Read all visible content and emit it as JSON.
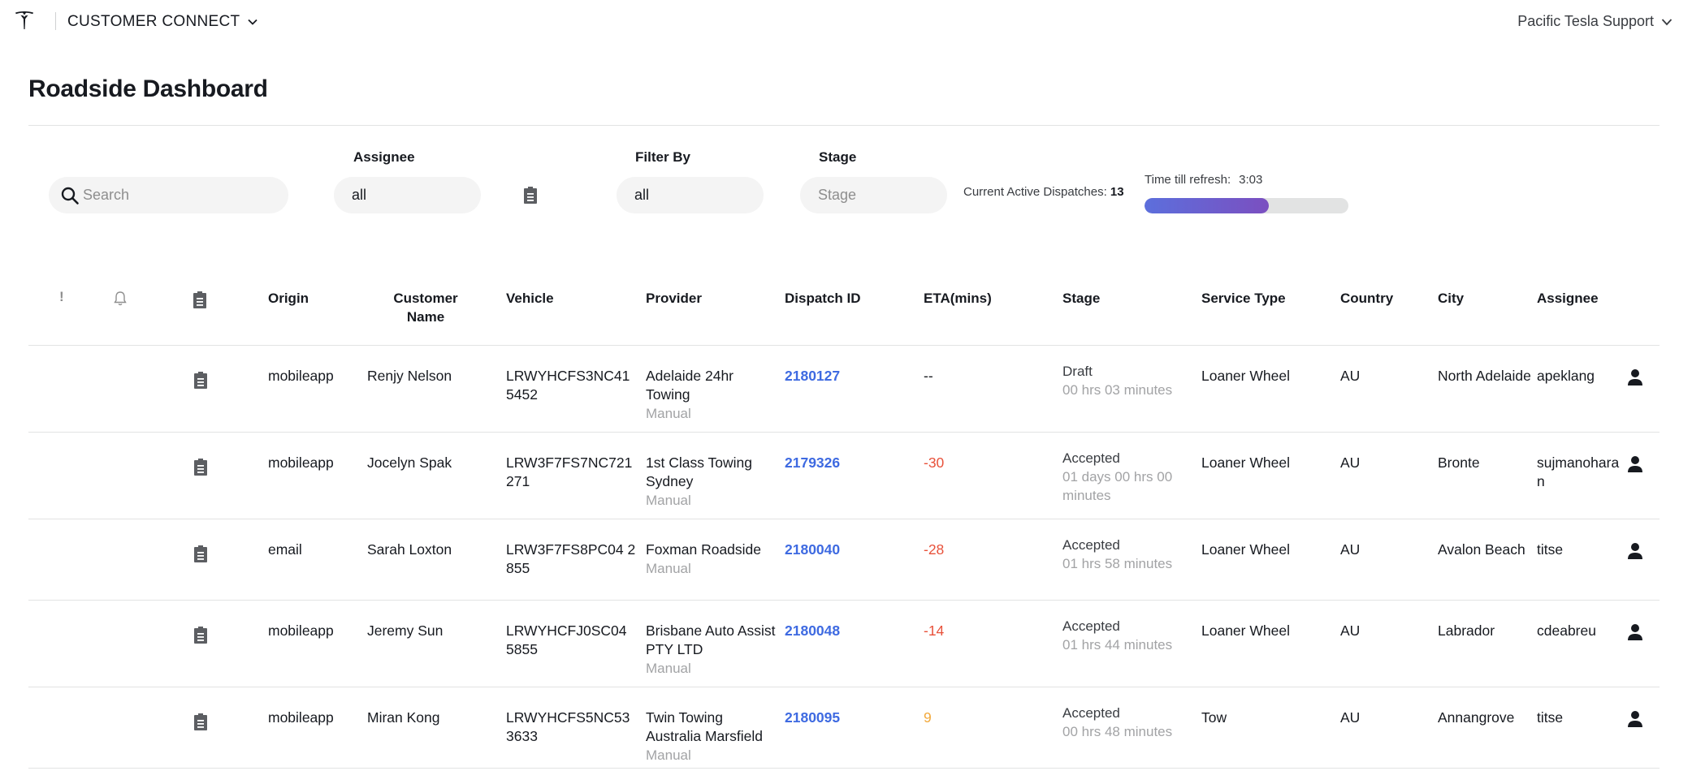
{
  "header": {
    "app_name": "CUSTOMER CONNECT",
    "org_name": "Pacific Tesla Support",
    "logo": "tesla-logo"
  },
  "page": {
    "title": "Roadside Dashboard"
  },
  "filters": {
    "search_placeholder": "Search",
    "assignee_label": "Assignee",
    "assignee_value": "all",
    "filter_by_label": "Filter By",
    "filter_by_value": "all",
    "stage_label": "Stage",
    "stage_placeholder": "Stage",
    "active_dispatches_label": "Current Active Dispatches:",
    "active_dispatches_count": "13",
    "refresh_label": "Time till refresh:",
    "refresh_time": "3:03",
    "refresh_progress_fraction": 0.61,
    "progress_gradient": [
      "#5c6fdc",
      "#7b4fc0"
    ]
  },
  "table": {
    "columns": {
      "priority": "!",
      "origin": "Origin",
      "customer_name": "Customer Name",
      "vehicle": "Vehicle",
      "provider": "Provider",
      "dispatch_id": "Dispatch ID",
      "eta": "ETA(mins)",
      "stage": "Stage",
      "service_type": "Service Type",
      "country": "Country",
      "city": "City",
      "assignee": "Assignee"
    },
    "rows": [
      {
        "origin": "mobileapp",
        "customer": "Renjy Nelson",
        "vehicle": "LRWYHCFS3NC41 5452",
        "provider": "Adelaide 24hr Towing",
        "provider_type": "Manual",
        "dispatch_id": "2180127",
        "eta": "--",
        "eta_kind": "none",
        "stage": "Draft",
        "stage_duration": "00 hrs 03 minutes",
        "service_type": "Loaner Wheel",
        "country": "AU",
        "city": "North Adelaide",
        "assignee": "apeklang"
      },
      {
        "origin": "mobileapp",
        "customer": "Jocelyn Spak",
        "vehicle": "LRW3F7FS7NC721 271",
        "provider": "1st Class Towing Sydney",
        "provider_type": "Manual",
        "dispatch_id": "2179326",
        "eta": "-30",
        "eta_kind": "neg",
        "stage": "Accepted",
        "stage_duration": "01 days 00 hrs 00 minutes",
        "service_type": "Loaner Wheel",
        "country": "AU",
        "city": "Bronte",
        "assignee": "sujmanoharan"
      },
      {
        "origin": "email",
        "customer": "Sarah Loxton",
        "vehicle": "LRW3F7FS8PC04 2855",
        "provider": "Foxman Roadside",
        "provider_type": "Manual",
        "dispatch_id": "2180040",
        "eta": "-28",
        "eta_kind": "neg",
        "stage": "Accepted",
        "stage_duration": "01 hrs 58 minutes",
        "service_type": "Loaner Wheel",
        "country": "AU",
        "city": "Avalon Beach",
        "assignee": "titse"
      },
      {
        "origin": "mobileapp",
        "customer": "Jeremy Sun",
        "vehicle": "LRWYHCFJ0SC04 5855",
        "provider": "Brisbane Auto Assist PTY LTD",
        "provider_type": "Manual",
        "dispatch_id": "2180048",
        "eta": "-14",
        "eta_kind": "neg",
        "stage": "Accepted",
        "stage_duration": "01 hrs 44 minutes",
        "service_type": "Loaner Wheel",
        "country": "AU",
        "city": "Labrador",
        "assignee": "cdeabreu"
      },
      {
        "origin": "mobileapp",
        "customer": "Miran Kong",
        "vehicle": "LRWYHCFS5NC53 3633",
        "provider": "Twin Towing Australia Marsfield",
        "provider_type": "Manual",
        "dispatch_id": "2180095",
        "eta": "9",
        "eta_kind": "pos",
        "stage": "Accepted",
        "stage_duration": "00 hrs 48 minutes",
        "service_type": "Tow",
        "country": "AU",
        "city": "Annangrove",
        "assignee": "titse"
      }
    ]
  },
  "colors": {
    "link": "#3e6ae1",
    "eta_negative": "#e8513a",
    "eta_positive": "#f2a93b",
    "muted": "#a2a3a5"
  },
  "icons": {
    "search": "search-icon",
    "note": "note-icon",
    "bell": "bell-icon",
    "user": "user-icon",
    "chevron": "chevron-down-icon"
  }
}
